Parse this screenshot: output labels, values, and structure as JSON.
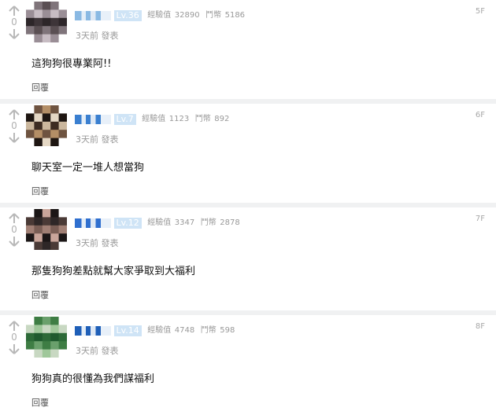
{
  "comments": [
    {
      "floor": "5F",
      "vote_count": "0",
      "level": "Lv.36",
      "exp_label": "經驗值",
      "exp_value": "32890",
      "coin_label": "鬥幣",
      "coin_value": "5186",
      "time": "3天前",
      "action": "發表",
      "content": "這狗狗很專業阿!!",
      "reply_label": "回覆",
      "avatar_colors": [
        "#5a4f53",
        "#9a8e96",
        "#2d2629",
        "#7f747a",
        "#c7bcc3",
        "#3e3539"
      ],
      "name_color": "#8ab9e3"
    },
    {
      "floor": "6F",
      "vote_count": "0",
      "level": "Lv.7",
      "exp_label": "經驗值",
      "exp_value": "1123",
      "coin_label": "鬥幣",
      "coin_value": "892",
      "time": "3天前",
      "action": "發表",
      "content": "聊天室一定一堆人想當狗",
      "reply_label": "回覆",
      "avatar_colors": [
        "#3d2c22",
        "#b38e66",
        "#1e1612",
        "#cbb79d",
        "#6e5340",
        "#e4d7c4"
      ],
      "name_color": "#3a7fd0"
    },
    {
      "floor": "7F",
      "vote_count": "0",
      "level": "Lv.12",
      "exp_label": "經驗值",
      "exp_value": "3347",
      "coin_label": "鬥幣",
      "coin_value": "2878",
      "time": "3天前",
      "action": "發表",
      "content": "那隻狗狗差點就幫大家爭取到大福利",
      "reply_label": "回覆",
      "avatar_colors": [
        "#2e2727",
        "#7a5e55",
        "#c9a59a",
        "#4a3a36",
        "#a07f74",
        "#1b1616"
      ],
      "name_color": "#2f6fcf"
    },
    {
      "floor": "8F",
      "vote_count": "0",
      "level": "Lv.14",
      "exp_label": "經驗值",
      "exp_value": "4748",
      "coin_label": "鬥幣",
      "coin_value": "598",
      "time": "3天前",
      "action": "發表",
      "content": "狗狗真的很懂為我們謀福利",
      "reply_label": "回覆",
      "avatar_colors": [
        "#3e7d44",
        "#9fc79a",
        "#1f5a2e",
        "#6aa06c",
        "#c8d8c2",
        "#2d6a38"
      ],
      "name_color": "#1f5fb8"
    }
  ]
}
